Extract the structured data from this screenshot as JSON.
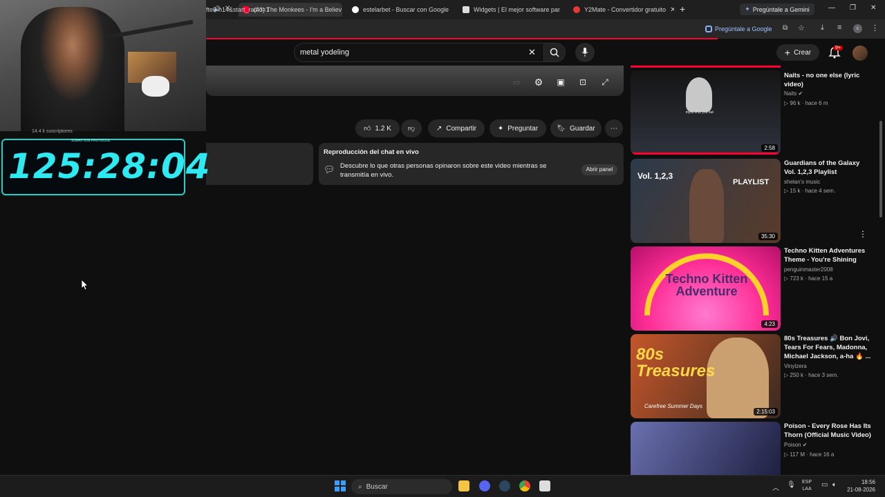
{
  "browser": {
    "tabs": [
      {
        "title": "(43) The Monkees - I'm a Believ",
        "color": "#ff0033"
      },
      {
        "title": "estelarbet - Buscar con Google",
        "color": "#4285f4"
      },
      {
        "title": "Widgets | El mejor software par",
        "color": "#e8e8e8"
      },
      {
        "title": "Y2Mate - Convertidor gratuito",
        "color": "#e53935"
      }
    ],
    "new_tab": "+",
    "gemini_label": "Pregúntale a Gemini",
    "url": "fte0-h14&start_radio=1",
    "ask_google": "Pregúntale a Google"
  },
  "youtube": {
    "search_value": "metal yodeling",
    "create_label": "Crear",
    "notif_count": "9+",
    "likes": "1.2 K",
    "share": "Compartir",
    "ask": "Preguntar",
    "save": "Guardar",
    "chat_title": "Reproducción del chat en vivo",
    "chat_desc": "Descubre lo que otras personas opinaron sobre este video mientras se transmitía en vivo.",
    "open_panel": "Abrir panel",
    "subscribers": "14.4 k suscriptores"
  },
  "stream_overlay": {
    "timer": "125:28:04",
    "frame_label": "SUBATHON PROTOCOL"
  },
  "recommendations": [
    {
      "title": "Naits - no one else (lyric video)",
      "channel": "Naits",
      "verified": true,
      "views": "96 k",
      "age": "hace 6 m",
      "duration": "2:58",
      "thumb_text": "tryna shut you out",
      "colors": [
        "#1a1a1a",
        "#3a3f4a"
      ]
    },
    {
      "title": "Guardians of the Galaxy Vol. 1,2,3 Playlist",
      "channel": "shelan's music",
      "verified": false,
      "views": "15 k",
      "age": "hace 4 sem.",
      "duration": "35:30",
      "thumb_text": "Vol. 1,2,3",
      "thumb_tag": "PLAYLIST",
      "colors": [
        "#2b3a4a",
        "#5a3b2a"
      ]
    },
    {
      "title": "Techno Kitten Adventures Theme - You're Shining",
      "channel": "penguinmaster2008",
      "verified": false,
      "views": "723 k",
      "age": "hace 15 a",
      "duration": "4:23",
      "thumb_text": "Techno Kitten Adventure",
      "colors": [
        "#ff2d95",
        "#ffd12b"
      ]
    },
    {
      "title": "80s Treasures 🔊 Bon Jovi, Tears For Fears, Madonna, Michael Jackson, a-ha 🔥 ...",
      "channel": "Vinylzera",
      "verified": false,
      "views": "250 k",
      "age": "hace 3 sem.",
      "duration": "2:15:03",
      "thumb_text": "80s Treasures",
      "thumb_sub": "Carefree Summer Days",
      "colors": [
        "#c5562a",
        "#3a2a1f"
      ]
    },
    {
      "title": "Poison - Every Rose Has Its Thorn (Official Music Video)",
      "channel": "Poison",
      "verified": true,
      "views": "117 M",
      "age": "hace 16 a",
      "duration": "",
      "thumb_text": "",
      "colors": [
        "#4a4f80",
        "#1e2040"
      ]
    }
  ],
  "taskbar": {
    "search_placeholder": "Buscar",
    "lang": "ESP",
    "lang_sub": "LAA",
    "time": "18:56",
    "date": "21-08-2026"
  }
}
